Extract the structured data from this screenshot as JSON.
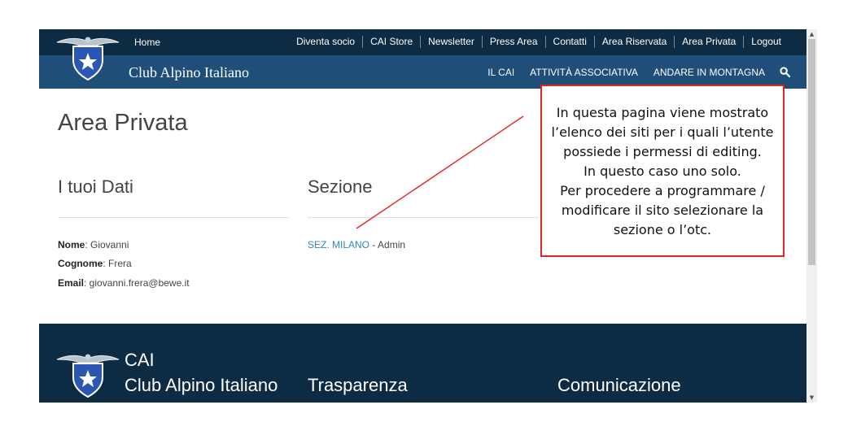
{
  "topbar": {
    "home": "Home",
    "links": [
      "Diventa socio",
      "CAI Store",
      "Newsletter",
      "Press Area",
      "Contatti",
      "Area Riservata",
      "Area Privata",
      "Logout"
    ]
  },
  "mainbar": {
    "brand": "Club Alpino Italiano",
    "nav": [
      "IL CAI",
      "ATTIVITÀ ASSOCIATIVA",
      "ANDARE IN MONTAGNA"
    ],
    "search_icon": "search-icon"
  },
  "main": {
    "title": "Area Privata",
    "dati": {
      "heading": "I tuoi Dati",
      "nome_label": "Nome",
      "nome_value": ": Giovanni",
      "cognome_label": "Cognome",
      "cognome_value": ": Frera",
      "email_label": "Email",
      "email_value": ": giovanni.frera@bewe.it"
    },
    "sezione": {
      "heading": "Sezione",
      "link": "SEZ. MILANO",
      "role": " - Admin"
    }
  },
  "footer": {
    "cai": "CAI",
    "club": "Club Alpino Italiano",
    "trasparenza": "Trasparenza",
    "comunicazione": "Comunicazione"
  },
  "callout": {
    "lines": [
      "In questa pagina viene mostrato",
      "l’elenco dei siti per i quali l’utente",
      "possiede i permessi di editing.",
      "In questo caso uno solo.",
      "Per procedere a programmare /",
      "modificare il sito selezionare la",
      "sezione o l’otc."
    ]
  },
  "colors": {
    "topbar": "#0d2b43",
    "mainbar": "#1f4e79",
    "link": "#2e86c1",
    "callout_border": "#e0261c"
  }
}
